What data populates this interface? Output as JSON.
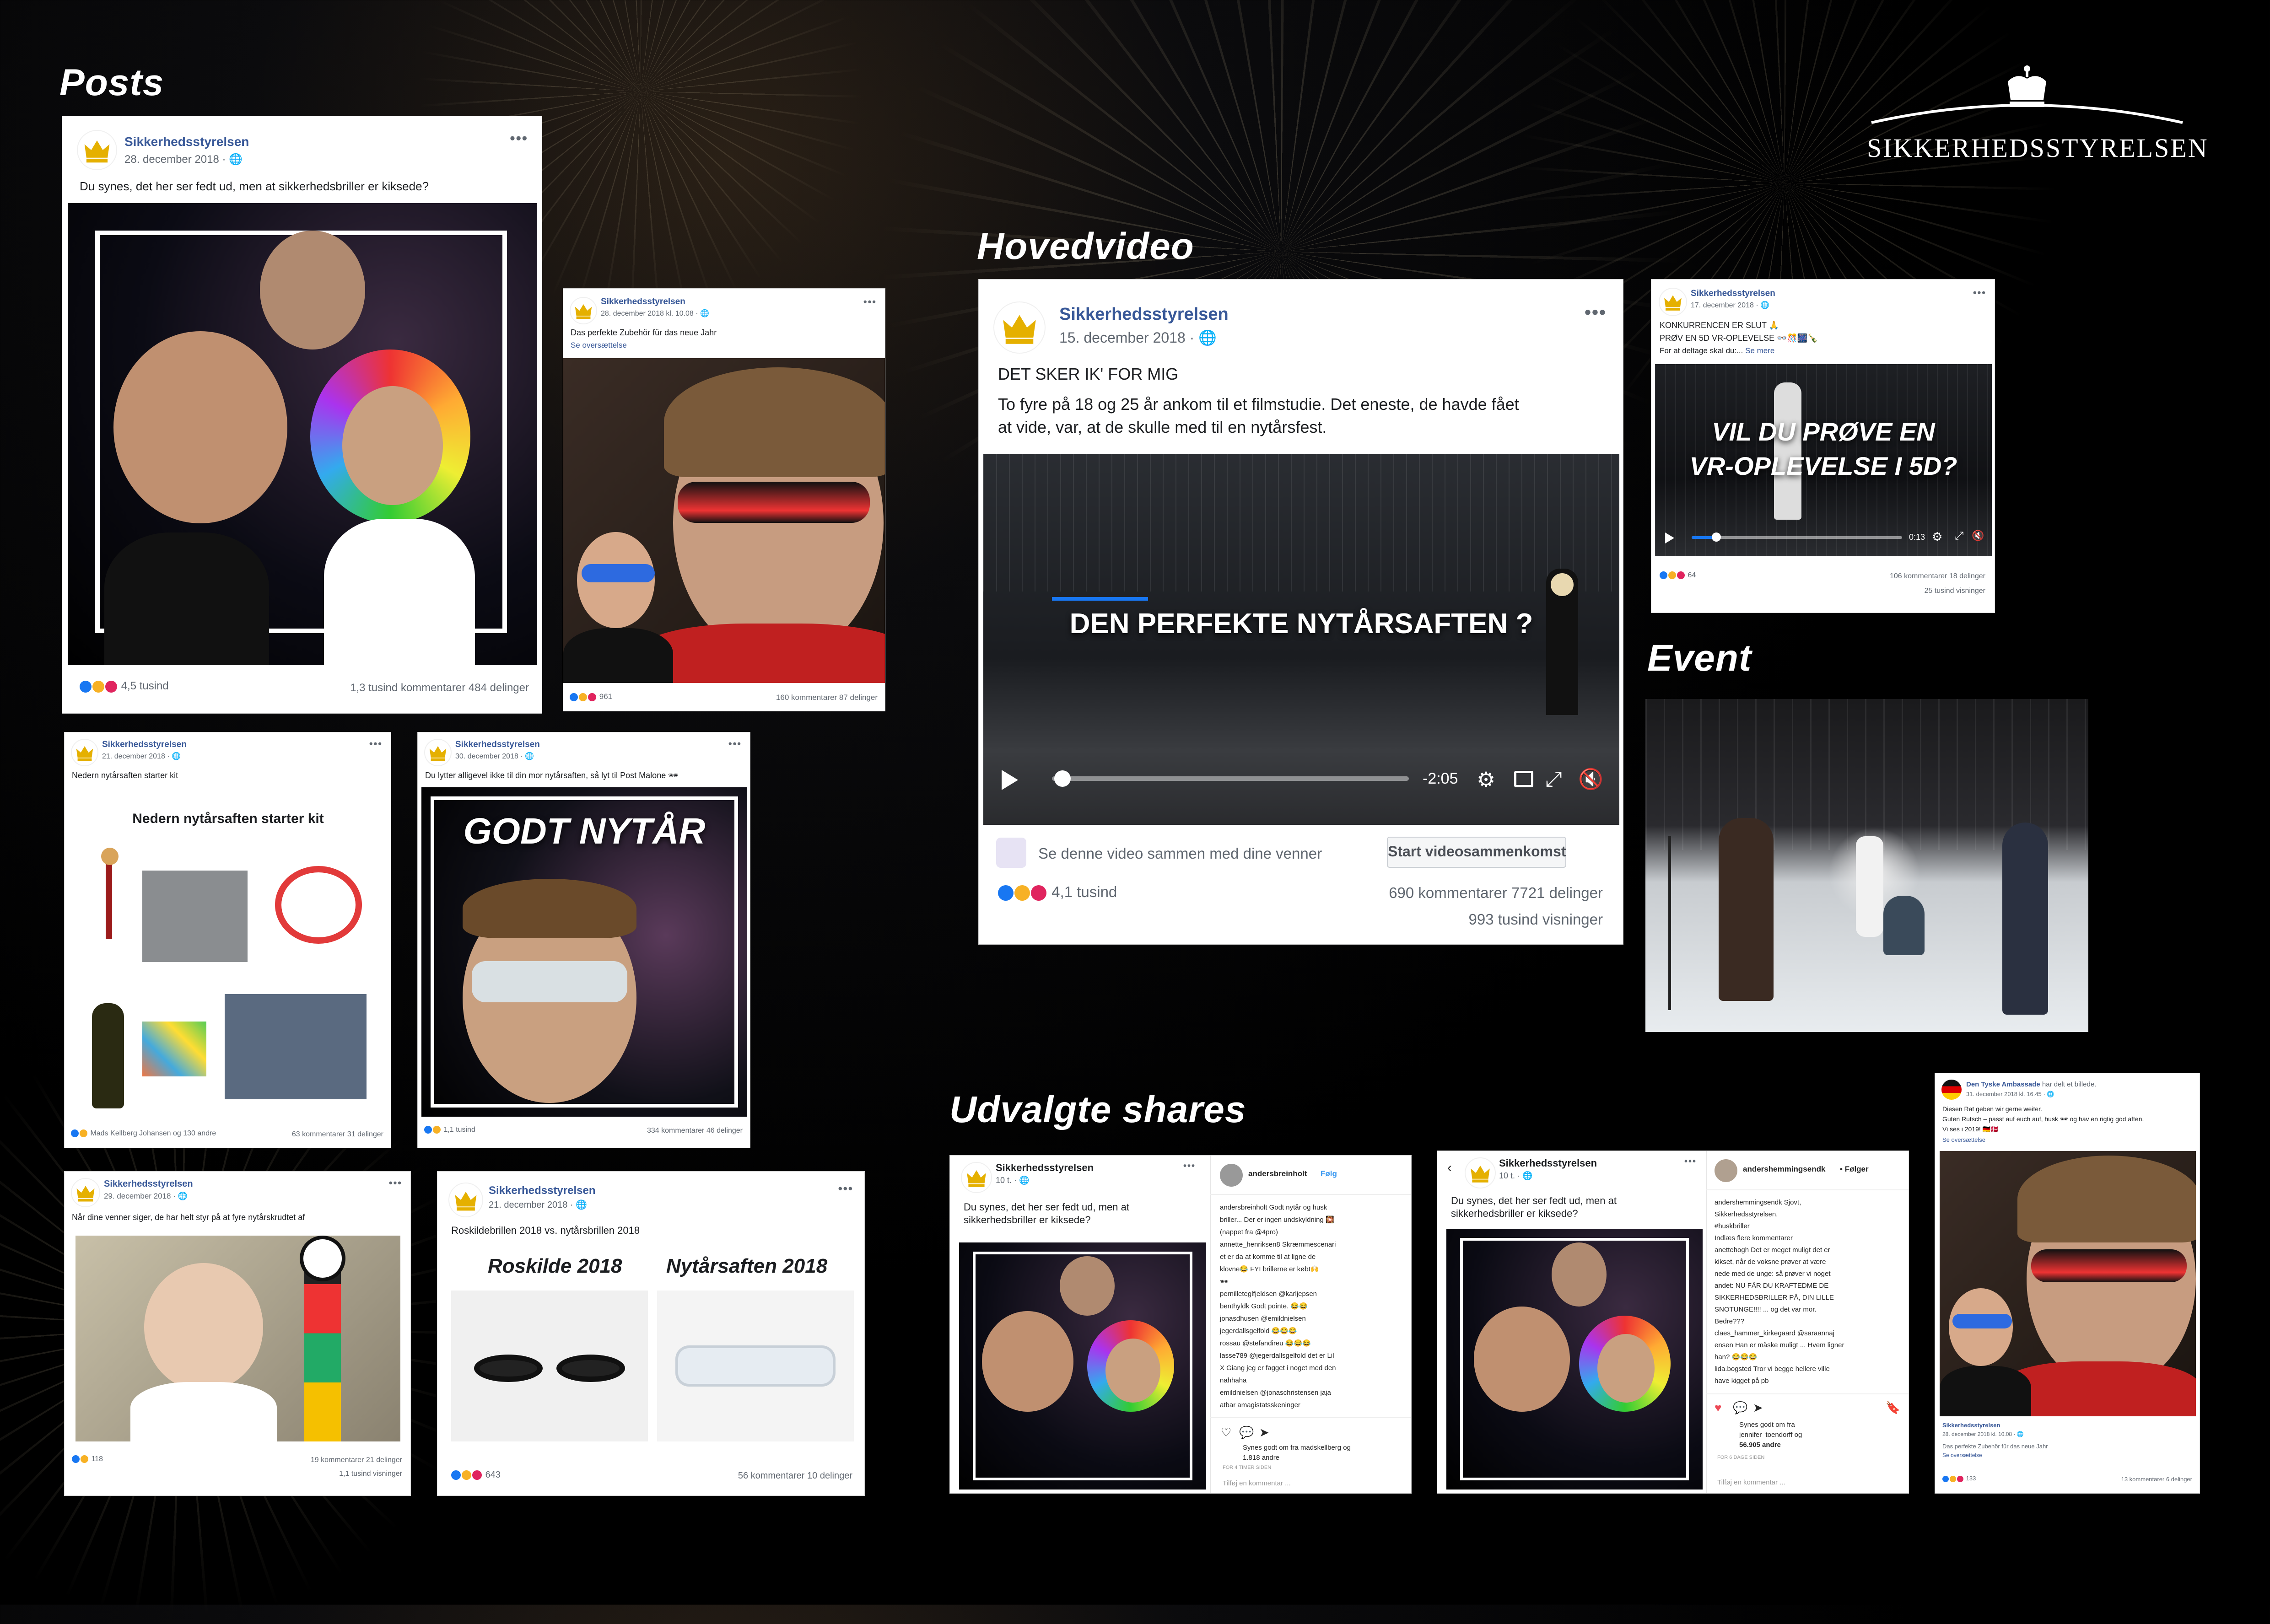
{
  "headings": {
    "posts": "Posts",
    "main_video": "Hovedvideo",
    "event": "Event",
    "shares": "Udvalgte shares"
  },
  "logo": {
    "name": "SIKKERHEDSSTYRELSEN",
    "icon": "crown-icon"
  },
  "page_name": "Sikkerhedsstyrelsen",
  "colors": {
    "fb_blue": "#385898",
    "like": "#1877f2",
    "ig_heart": "#ed4956"
  },
  "posts": [
    {
      "date": "28. december 2018 · ",
      "text": "Du synes, det her ser fedt ud, men at sikkerhedsbriller er kiksede?",
      "reactions": "4,5 tusind",
      "comments": "1,3 tusind kommentarer",
      "shares": "484 delinger"
    },
    {
      "date": "28. december 2018 kl. 10.08 · ",
      "text": "Das perfekte Zubehör für das neue Jahr",
      "translate": "Se oversættelse",
      "reactions": "961",
      "comments": "160 kommentarer",
      "shares": "87 delinger"
    },
    {
      "date": "21. december 2018 · ",
      "text": "Nedern nytårsaften starter kit",
      "image_title": "Nedern nytårsaften starter kit",
      "reactions": "Mads Kellberg Johansen og 130 andre",
      "comments": "63 kommentarer",
      "shares": "31 delinger"
    },
    {
      "date": "30. december 2018 · ",
      "text": "Du lytter alligevel ikke til din mor nytårsaften, så lyt til Post Malone 🕶",
      "image_title": "GODT NYTÅR",
      "reactions": "1,1 tusind",
      "comments": "334 kommentarer",
      "shares": "46 delinger"
    },
    {
      "date": "29. december 2018 · ",
      "text": "Når dine venner siger, de har helt styr på at fyre nytårskrudtet af",
      "reactions": "118",
      "comments": "19 kommentarer",
      "shares": "21 delinger",
      "views": "1,1 tusind visninger"
    },
    {
      "date": "21. december 2018 · ",
      "text": "Roskildebrillen 2018 vs. nytårsbrillen 2018",
      "label_left": "Roskilde 2018",
      "label_right": "Nytårsaften 2018",
      "reactions": "643",
      "comments": "56 kommentarer",
      "shares": "10 delinger"
    }
  ],
  "main_video": {
    "date": "15. december 2018 · ",
    "line1": "DET SKER IK' FOR MIG",
    "line2": "To fyre på 18 og 25 år ankom til et filmstudie. Det eneste, de havde fået",
    "line3": "at vide, var, at de skulle med til en nytårsfest.",
    "overlay": "DEN PERFEKTE NYTÅRSAFTEN ?",
    "time": "-2:05",
    "watch_together": "Se denne video sammen med dine venner",
    "watch_button": "Start videosammenkomst",
    "reactions": "4,1 tusind",
    "comments": "690 kommentarer",
    "shares": "7721 delinger",
    "views": "993 tusind visninger"
  },
  "vr_post": {
    "date": "17. december 2018 · ",
    "line1": "KONKURRENCEN ER SLUT 🙏",
    "line2": "PRØV EN 5D VR-OPLEVELSE 👓🎊🎆🍾",
    "line3": "For at deltage skal du:... ",
    "more": "Se mere",
    "overlay1": "VIL DU PRØVE EN",
    "overlay2": "VR-OPLEVELSE I 5D?",
    "time": "0:13",
    "reactions": "64",
    "comments": "106 kommentarer",
    "shares": "18 delinger",
    "views": "25 tusind visninger"
  },
  "shares": [
    {
      "page_time": "10 t. · ",
      "text1": "Du synes, det her ser fedt ud, men at",
      "text2": "sikkerhedsbriller er kiksede?",
      "user": "andersbreinholt",
      "follow": "Følg",
      "comments": [
        "andersbreinholt Godt nytår og husk",
        "briller... Der er ingen undskyldning 🎇",
        "(nappet fra @4pro)",
        "annette_henriksen8 Skræmmescenari",
        "et er da at komme til at ligne de",
        "klovne😂 FYI brillerne er købt🙌",
        "🕶",
        "pernilleteglfjeldsen @karljepsen",
        "benthyldk Godt pointe. 😂😂",
        "jonasdhusen @emildnielsen",
        "jegerdallsgelfold 😂😂😂",
        "rossau @stefandireu 😂😂😂",
        "lasse789 @jegerdallsgelfold det er Lil",
        "X Giang jeg er fagget i noget med den",
        "nahhaha",
        "emildnielsen @jonaschristensen jaja",
        "atbar amagistatsskeninger"
      ],
      "likes1": "Synes godt om fra madskellberg og",
      "likes2": "1.818 andre",
      "stamp": "FOR 4 TIMER SIDEN",
      "add_comment": "Tilføj en kommentar ..."
    },
    {
      "page_time": "10 t. · ",
      "text1": "Du synes, det her ser fedt ud, men at",
      "text2": "sikkerhedsbriller er kiksede?",
      "user": "andershemmingsendk",
      "follow": "• Følger",
      "comments": [
        "andershemmingsendk Sjovt,",
        "Sikkerhedsstyrelsen.",
        "#huskbriller",
        "Indlæs flere kommentarer",
        "anettehogh Det er meget muligt det er",
        "kikset, når de voksne prøver at være",
        "nede med de unge: så prøver vi noget",
        "andet: NU FÅR DU KRAFTEDME DE",
        "SIKKERHEDSBRILLER PÅ, DIN LILLE",
        "SNOTUNGE!!!! ... og det var mor.",
        "Bedre???",
        "claes_hammer_kirkegaard @saraannaj",
        "ensen Han er måske muligt ... Hvem ligner",
        "han? 😂😂😂",
        "lida.bogsted Tror vi begge hellere ville",
        "have kigget på pb"
      ],
      "likes1": "Synes godt om fra",
      "likes2": "jennifer_toendorff og",
      "likes3": "56.905 andre",
      "stamp": "FOR 6 DAGE SIDEN",
      "add_comment": "Tilføj en kommentar ..."
    }
  ],
  "embassy": {
    "name": "Den Tyske Ambassade",
    "shared": " har delt et billede.",
    "date": "31. december 2018 kl. 16.45 · ",
    "line1": "Diesen Rat geben wir gerne weiter.",
    "line2": "Guten Rutsch – passt auf euch auf, husk 🕶 og hav en rigtig god aften.",
    "line3": "Vi ses i 2019! 🇩🇪🇩🇰",
    "translate": "Se oversættelse",
    "orig_name": "Sikkerhedsstyrelsen",
    "orig_date": "28. december 2018 kl. 10.08 · ",
    "orig_text": "Das perfekte Zubehör für das neue Jahr",
    "orig_translate": "Se oversættelse",
    "reactions": "133",
    "comments": "13 kommentarer",
    "shares": "6 delinger"
  }
}
